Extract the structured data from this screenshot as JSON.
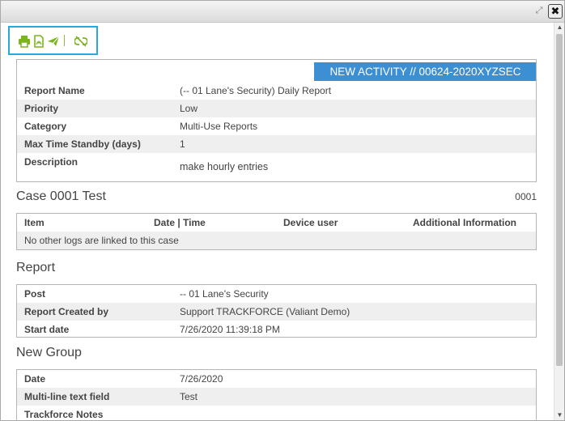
{
  "window": {
    "expand_icon": "expand-icon",
    "close_icon": "close-icon",
    "close_glyph": "✖"
  },
  "toolbar": {
    "icons": [
      "print-icon",
      "pdf-icon",
      "send-icon",
      "unlink-icon"
    ],
    "accent_color": "#7ab51d",
    "highlight_color": "#29a8e0"
  },
  "activity": {
    "badge": "NEW ACTIVITY // 00624-2020XYZSEC",
    "badge_color": "#3d8fd4",
    "fields": [
      {
        "key": "Report Name",
        "value": "(-- 01 Lane's Security) Daily Report"
      },
      {
        "key": "Priority",
        "value": "Low"
      },
      {
        "key": "Category",
        "value": "Multi-Use Reports"
      },
      {
        "key": "Max Time Standby (days)",
        "value": "1"
      },
      {
        "key": "Description",
        "value": "make hourly entries"
      }
    ]
  },
  "case": {
    "title": "Case  0001 Test",
    "number": "0001",
    "columns": [
      "Item",
      "Date | Time",
      "Device user",
      "Additional Information"
    ],
    "empty_message": "No other logs are linked to this case"
  },
  "report": {
    "title": "Report",
    "fields": [
      {
        "key": "Post",
        "value": "-- 01 Lane's Security"
      },
      {
        "key": "Report Created by",
        "value": "Support TRACKFORCE (Valiant Demo)"
      },
      {
        "key": "Start date",
        "value": "7/26/2020 11:39:18 PM"
      }
    ]
  },
  "group": {
    "title": "New Group",
    "fields": [
      {
        "key": "Date",
        "value": "7/26/2020"
      },
      {
        "key": "Multi-line text field",
        "value": "Test"
      },
      {
        "key": "Trackforce Notes",
        "value": ""
      }
    ]
  }
}
